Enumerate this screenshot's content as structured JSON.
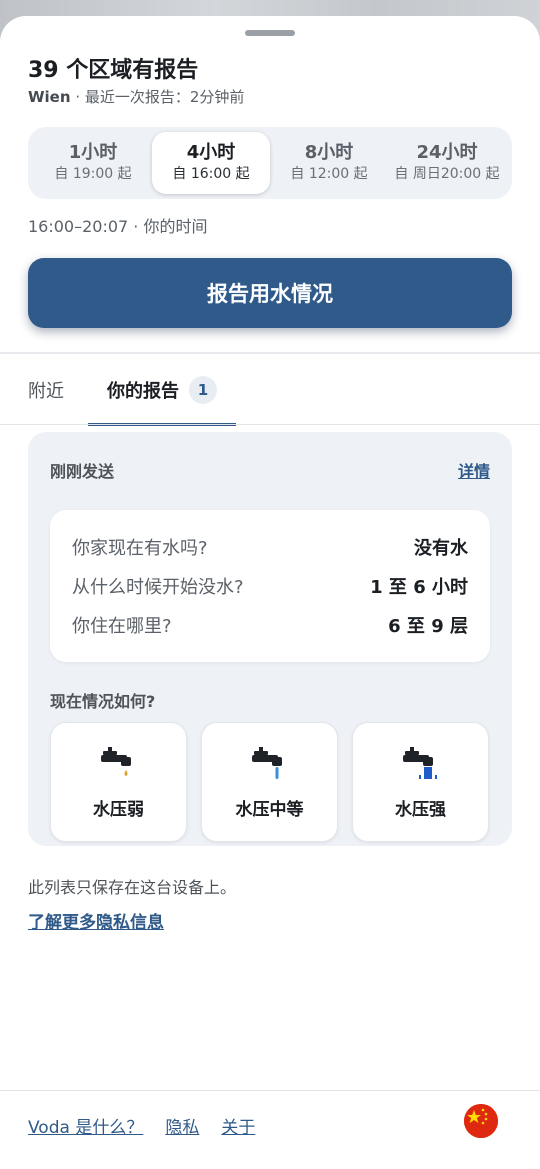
{
  "header": {
    "title": "39 个区域有报告",
    "city": "Wien",
    "last_report": " · 最近一次报告：2分钟前"
  },
  "time_filter": {
    "options": [
      {
        "label": "1小时",
        "since": "自 19:00 起",
        "active": false
      },
      {
        "label": "4小时",
        "since": "自 16:00 起",
        "active": true
      },
      {
        "label": "8小时",
        "since": "自 12:00 起",
        "active": false
      },
      {
        "label": "24小时",
        "since": "自 周日20:00 起",
        "active": false
      }
    ],
    "range_text": "16:00–20:07 · 你的时间"
  },
  "report_button": "报告用水情况",
  "tabs": {
    "nearby": "附近",
    "mine": "你的报告",
    "mine_count": "1"
  },
  "report_card": {
    "heading": "刚刚发送",
    "details_link": "详情",
    "answers": [
      {
        "q": "你家现在有水吗?",
        "a": "没有水"
      },
      {
        "q": "从什么时候开始没水?",
        "a": "1 至 6 小时"
      },
      {
        "q": "你住在哪里?",
        "a": "6 至 9 层"
      }
    ],
    "now_heading": "现在情况如何?",
    "pressure_options": [
      {
        "label": "水压弱",
        "icon": "faucet-drip-icon"
      },
      {
        "label": "水压中等",
        "icon": "faucet-stream-icon"
      },
      {
        "label": "水压强",
        "icon": "faucet-strong-icon"
      }
    ]
  },
  "privacy": {
    "note": "此列表只保存在这台设备上。",
    "link": "了解更多隐私信息"
  },
  "footer": {
    "what_is": "Voda 是什么？",
    "privacy": "隐私",
    "about": "关于"
  },
  "colors": {
    "accent": "#2f5a8a",
    "card_bg": "#eef1f6",
    "water_drop": "#e0a030",
    "water_stream": "#3a8fd9",
    "water_strong": "#1e5cc8",
    "flag_red": "#de2910",
    "flag_star": "#ffde00"
  }
}
